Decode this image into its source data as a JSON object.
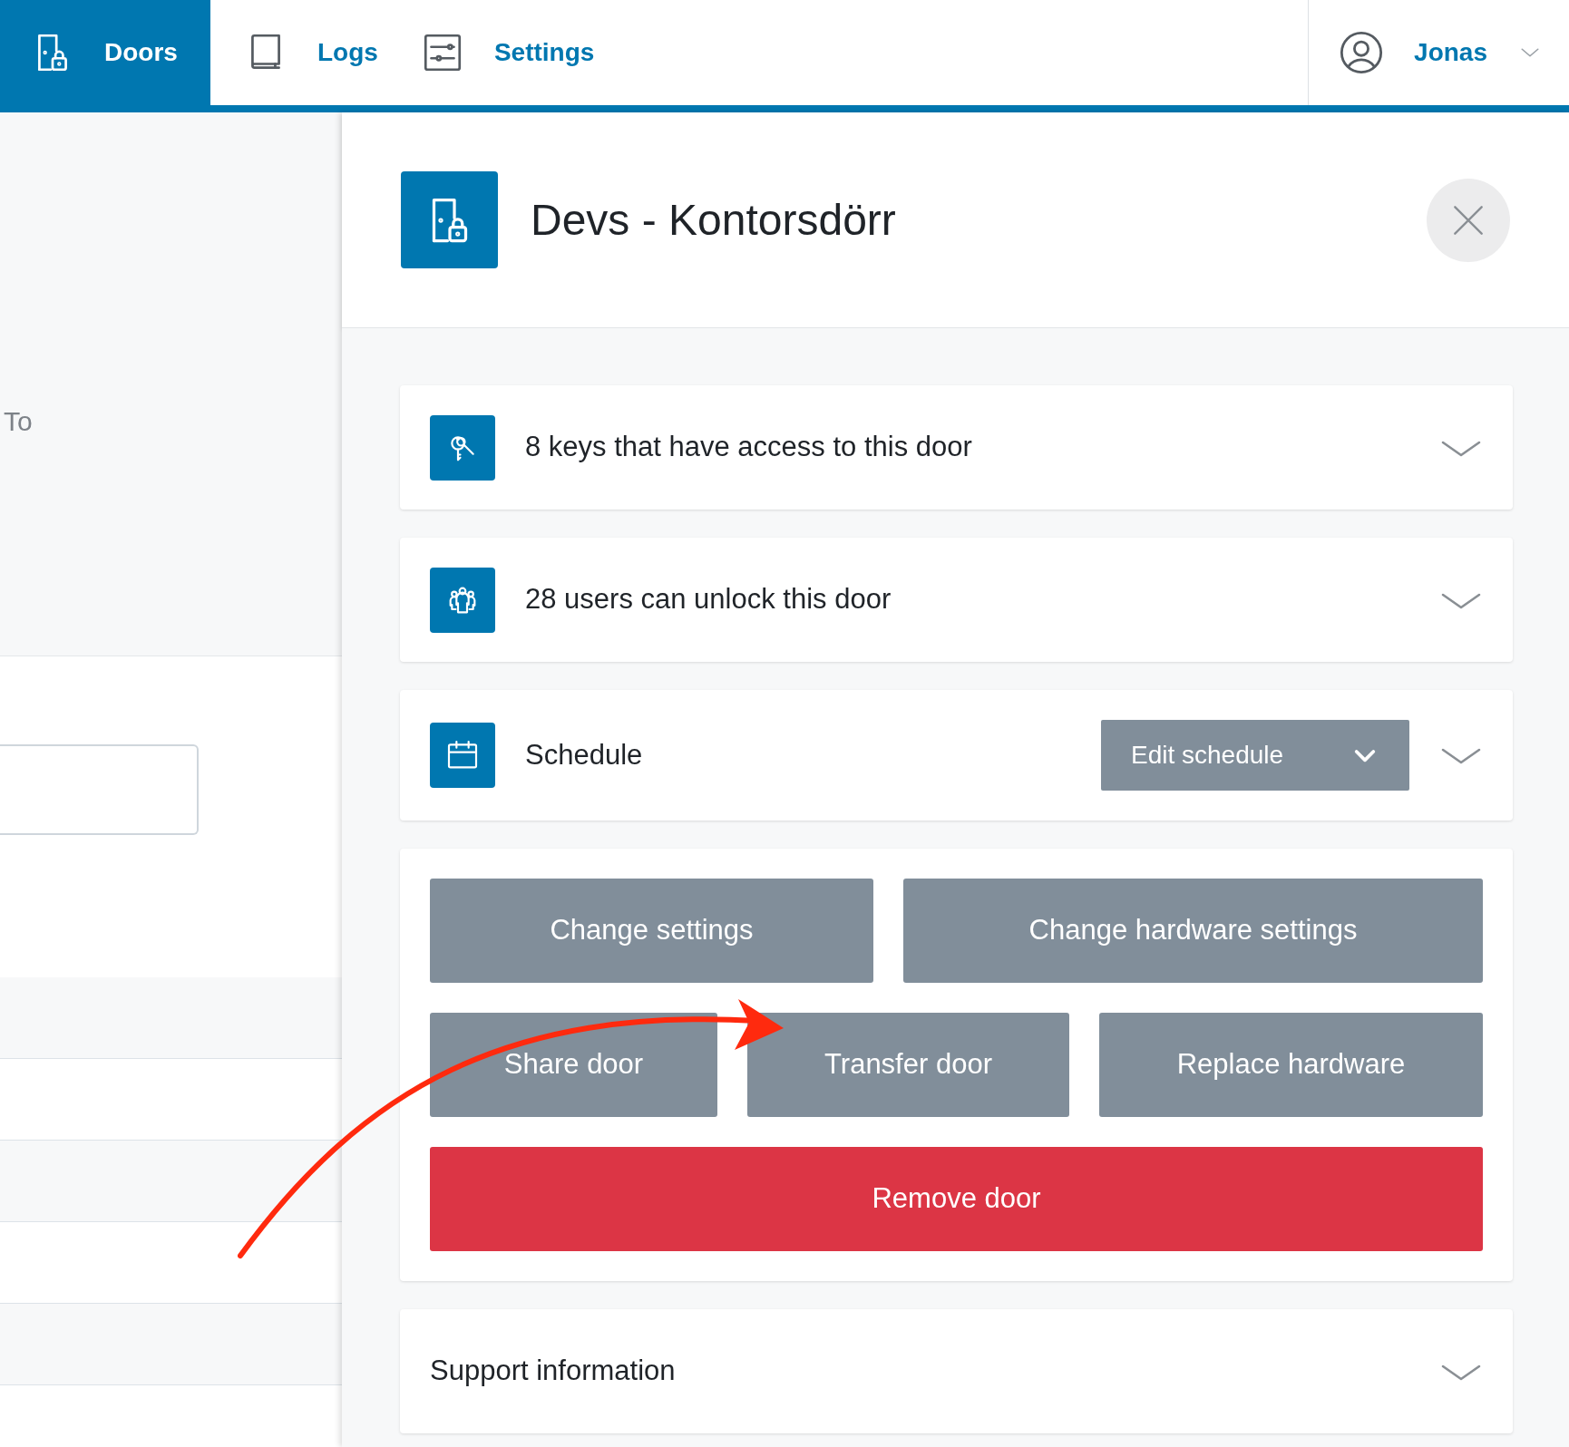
{
  "nav": {
    "tabs": [
      {
        "label": "Doors",
        "selected": true
      },
      {
        "label": "Logs",
        "selected": false
      },
      {
        "label": "Settings",
        "selected": false
      }
    ],
    "user": {
      "name": "Jonas"
    }
  },
  "background": {
    "column_label": "To"
  },
  "panel": {
    "title": "Devs - Kontorsdörr",
    "sections": [
      {
        "kind": "keys",
        "label": "8 keys that have access to this door",
        "expanded": false
      },
      {
        "kind": "users",
        "label": "28 users can unlock this door",
        "expanded": false
      },
      {
        "kind": "schedule",
        "label": "Schedule",
        "action": "Edit schedule",
        "expanded": false
      }
    ],
    "button_rows": [
      [
        {
          "label": "Change settings",
          "kind": "secondary"
        },
        {
          "label": "Change hardware settings",
          "kind": "secondary"
        }
      ],
      [
        {
          "label": "Share door",
          "kind": "secondary"
        },
        {
          "label": "Transfer door",
          "kind": "secondary"
        },
        {
          "label": "Replace hardware",
          "kind": "secondary"
        }
      ],
      [
        {
          "label": "Remove door",
          "kind": "danger"
        }
      ]
    ],
    "support": {
      "label": "Support information",
      "expanded": false
    }
  }
}
